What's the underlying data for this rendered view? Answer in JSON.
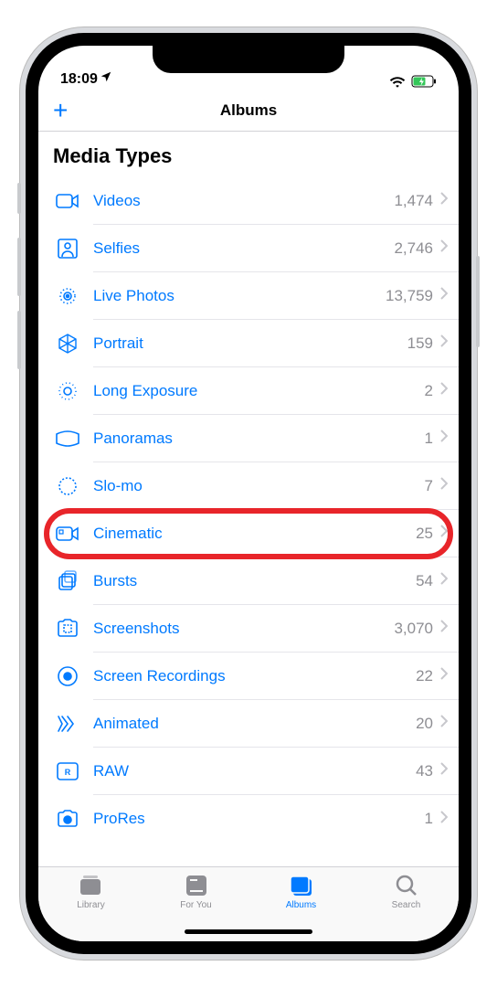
{
  "status": {
    "time": "18:09"
  },
  "nav": {
    "title": "Albums",
    "plus": "+"
  },
  "section": {
    "title": "Media Types"
  },
  "rows": [
    {
      "label": "Videos",
      "count": "1,474"
    },
    {
      "label": "Selfies",
      "count": "2,746"
    },
    {
      "label": "Live Photos",
      "count": "13,759"
    },
    {
      "label": "Portrait",
      "count": "159"
    },
    {
      "label": "Long Exposure",
      "count": "2"
    },
    {
      "label": "Panoramas",
      "count": "1"
    },
    {
      "label": "Slo-mo",
      "count": "7"
    },
    {
      "label": "Cinematic",
      "count": "25"
    },
    {
      "label": "Bursts",
      "count": "54"
    },
    {
      "label": "Screenshots",
      "count": "3,070"
    },
    {
      "label": "Screen Recordings",
      "count": "22"
    },
    {
      "label": "Animated",
      "count": "20"
    },
    {
      "label": "RAW",
      "count": "43"
    },
    {
      "label": "ProRes",
      "count": "1"
    }
  ],
  "tabs": [
    {
      "label": "Library"
    },
    {
      "label": "For You"
    },
    {
      "label": "Albums"
    },
    {
      "label": "Search"
    }
  ],
  "highlightedRow": 7
}
